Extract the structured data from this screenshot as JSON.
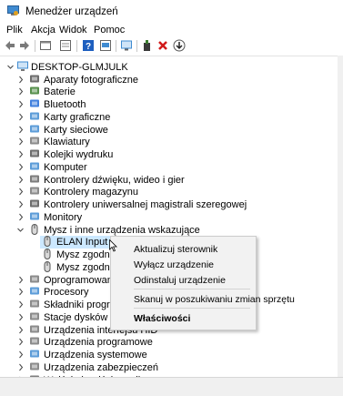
{
  "window": {
    "title": "Menedżer urządzeń"
  },
  "menu": [
    "Plik",
    "Akcja",
    "Widok",
    "Pomoc"
  ],
  "toolbar": {
    "icons": [
      "back-arrow-icon",
      "forward-arrow-icon",
      "properties-icon",
      "show-hidden-icon",
      "help-icon",
      "device-info-icon",
      "scan-monitor-icon",
      "add-driver-icon",
      "uninstall-x-icon",
      "update-download-icon"
    ]
  },
  "tree": {
    "root": "DESKTOP-GLMJULK",
    "items": [
      {
        "label": "Aparaty fotograficzne",
        "icon": "camera-icon",
        "color": "#555555"
      },
      {
        "label": "Baterie",
        "icon": "battery-icon",
        "color": "#3a7d2e"
      },
      {
        "label": "Bluetooth",
        "icon": "bluetooth-icon",
        "color": "#1e6ad8"
      },
      {
        "label": "Karty graficzne",
        "icon": "display-adapter-icon",
        "color": "#3f8bd1"
      },
      {
        "label": "Karty sieciowe",
        "icon": "network-adapter-icon",
        "color": "#3f8bd1"
      },
      {
        "label": "Klawiatury",
        "icon": "keyboard-icon",
        "color": "#777777"
      },
      {
        "label": "Kolejki wydruku",
        "icon": "printer-icon",
        "color": "#555555"
      },
      {
        "label": "Komputer",
        "icon": "computer-icon",
        "color": "#3f8bd1"
      },
      {
        "label": "Kontrolery dźwięku, wideo i gier",
        "icon": "speaker-icon",
        "color": "#666666"
      },
      {
        "label": "Kontrolery magazynu",
        "icon": "storage-controller-icon",
        "color": "#777777"
      },
      {
        "label": "Kontrolery uniwersalnej magistrali szeregowej",
        "icon": "usb-icon",
        "color": "#555555"
      },
      {
        "label": "Monitory",
        "icon": "monitor-icon",
        "color": "#3f8bd1"
      },
      {
        "label": "Mysz i inne urządzenia wskazujące",
        "icon": "mouse-icon",
        "color": "#777777",
        "expanded": true,
        "children": [
          "ELAN Input Device",
          "Mysz zgodna z HID",
          "Mysz zgodna z HID"
        ]
      },
      {
        "label": "Oprogramowanie urządzenia",
        "icon": "software-icon",
        "color": "#777777"
      },
      {
        "label": "Procesory",
        "icon": "processor-icon",
        "color": "#3f8bd1"
      },
      {
        "label": "Składniki programowe",
        "icon": "component-icon",
        "color": "#777777"
      },
      {
        "label": "Stacje dysków",
        "icon": "disk-drive-icon",
        "color": "#777777"
      },
      {
        "label": "Urządzenia interfejsu HID",
        "icon": "hid-icon",
        "color": "#777777"
      },
      {
        "label": "Urządzenia programowe",
        "icon": "software-device-icon",
        "color": "#777777"
      },
      {
        "label": "Urządzenia systemowe",
        "icon": "system-device-icon",
        "color": "#3f8bd1"
      },
      {
        "label": "Urządzenia zabezpieczeń",
        "icon": "security-device-icon",
        "color": "#777777"
      },
      {
        "label": "Wejścia i wyjścia audio",
        "icon": "audio-io-icon",
        "color": "#666666"
      }
    ],
    "visible_child_labels": [
      "ELAN Input Dev",
      "Mysz zgodna z",
      "Mysz zgodna z"
    ]
  },
  "context_menu": {
    "items": [
      "Aktualizuj sterownik",
      "Wyłącz urządzenie",
      "Odinstaluj urządzenie"
    ],
    "scan": "Skanuj w poszukiwaniu zmian sprzętu",
    "properties": "Właściwości"
  }
}
